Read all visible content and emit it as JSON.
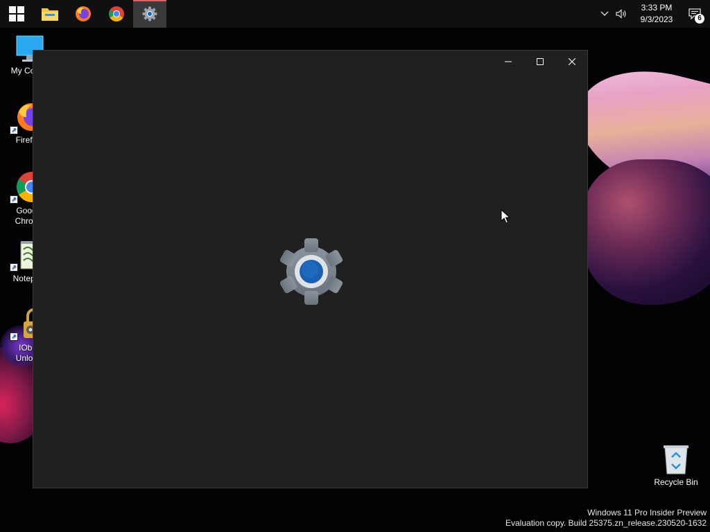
{
  "taskbar": {
    "apps": [
      {
        "name": "Start",
        "icon": "windows-logo-icon"
      },
      {
        "name": "File Explorer",
        "icon": "folder-icon"
      },
      {
        "name": "Firefox",
        "icon": "firefox-icon"
      },
      {
        "name": "Google Chrome",
        "icon": "chrome-icon"
      },
      {
        "name": "Settings",
        "icon": "gear-icon",
        "active": true
      }
    ],
    "tray": {
      "time": "3:33 PM",
      "date": "9/3/2023",
      "notification_count": "6"
    }
  },
  "desktop": {
    "icons": [
      {
        "label": "My Com",
        "icon": "monitor-icon"
      },
      {
        "label": "Firefo",
        "icon": "firefox-icon"
      },
      {
        "label": "Goog\nChron",
        "icon": "chrome-icon"
      },
      {
        "label": "Notepa",
        "icon": "notepad-icon"
      },
      {
        "label": "IObi\nUnloc",
        "icon": "lock-icon"
      },
      {
        "label": "Recycle Bin",
        "icon": "recycle-bin-icon"
      }
    ]
  },
  "window": {
    "app": "Settings",
    "state": "loading"
  },
  "watermark": {
    "line1": "Windows 11 Pro Insider Preview",
    "line2": "Evaluation copy. Build 25375.zn_release.230520-1632"
  }
}
